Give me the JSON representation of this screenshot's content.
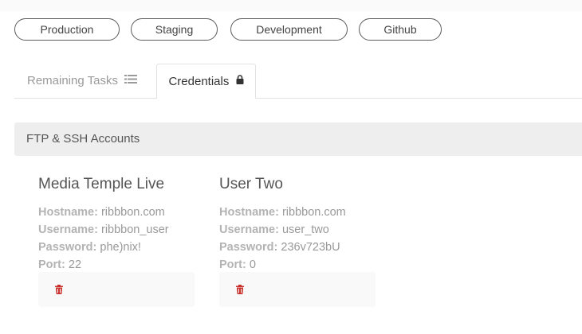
{
  "environments": [
    "Production",
    "Staging",
    "Development",
    "Github"
  ],
  "tabs": {
    "remaining_tasks": "Remaining Tasks",
    "credentials": "Credentials"
  },
  "section": {
    "title": "FTP & SSH Accounts"
  },
  "labels": {
    "hostname": "Hostname:",
    "username": "Username:",
    "password": "Password:",
    "port": "Port:"
  },
  "accounts": [
    {
      "name": "Media Temple Live",
      "hostname": "ribbbon.com",
      "username": "ribbbon_user",
      "password": "phe)nix!",
      "port": "22"
    },
    {
      "name": "User Two",
      "hostname": "ribbbon.com",
      "username": "user_two",
      "password": "236v723bU",
      "port": "0"
    }
  ],
  "colors": {
    "trash": "#c9302c",
    "border": "#5a5a5a",
    "header_bg": "#eeeeee"
  }
}
